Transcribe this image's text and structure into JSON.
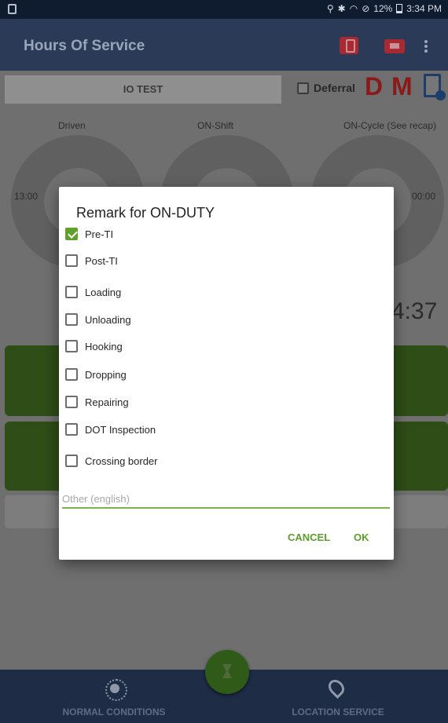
{
  "status_bar": {
    "battery": "12%",
    "time": "3:34 PM",
    "icons": [
      "location-icon",
      "bluetooth-icon",
      "wifi-icon",
      "do-not-disturb-icon",
      "battery-icon"
    ]
  },
  "app_bar": {
    "title": "Hours Of Service",
    "icons": [
      "phone-icon",
      "truck-icon",
      "more-icon"
    ]
  },
  "header": {
    "vehicle": "IO TEST",
    "deferral_label": "Deferral",
    "status_letters": [
      "D",
      "M"
    ]
  },
  "gauges": [
    {
      "label": "Driven",
      "value": "13:00"
    },
    {
      "label": "ON-Shift",
      "value": ""
    },
    {
      "label": "ON-Cycle (See recap)",
      "value": "00:00"
    }
  ],
  "partial_time": "4:37",
  "dialog": {
    "title": "Remark for ON-DUTY",
    "options": [
      {
        "label": "Pre-TI",
        "checked": true
      },
      {
        "label": "Post-TI",
        "checked": false
      },
      {
        "label": "Loading",
        "checked": false
      },
      {
        "label": "Unloading",
        "checked": false
      },
      {
        "label": "Hooking",
        "checked": false
      },
      {
        "label": "Dropping",
        "checked": false
      },
      {
        "label": "Repairing",
        "checked": false
      },
      {
        "label": "DOT Inspection",
        "checked": false
      },
      {
        "label": "Crossing border",
        "checked": false
      }
    ],
    "other_placeholder": "Other (english)",
    "cancel_label": "CANCEL",
    "ok_label": "OK"
  },
  "bottom_bar": {
    "normal_conditions": "NORMAL CONDITIONS",
    "location_service": "LOCATION SERVICE"
  },
  "colors": {
    "accent_green": "#5ea22c",
    "status_red": "#c0272d",
    "navy": "#2a3a57"
  }
}
